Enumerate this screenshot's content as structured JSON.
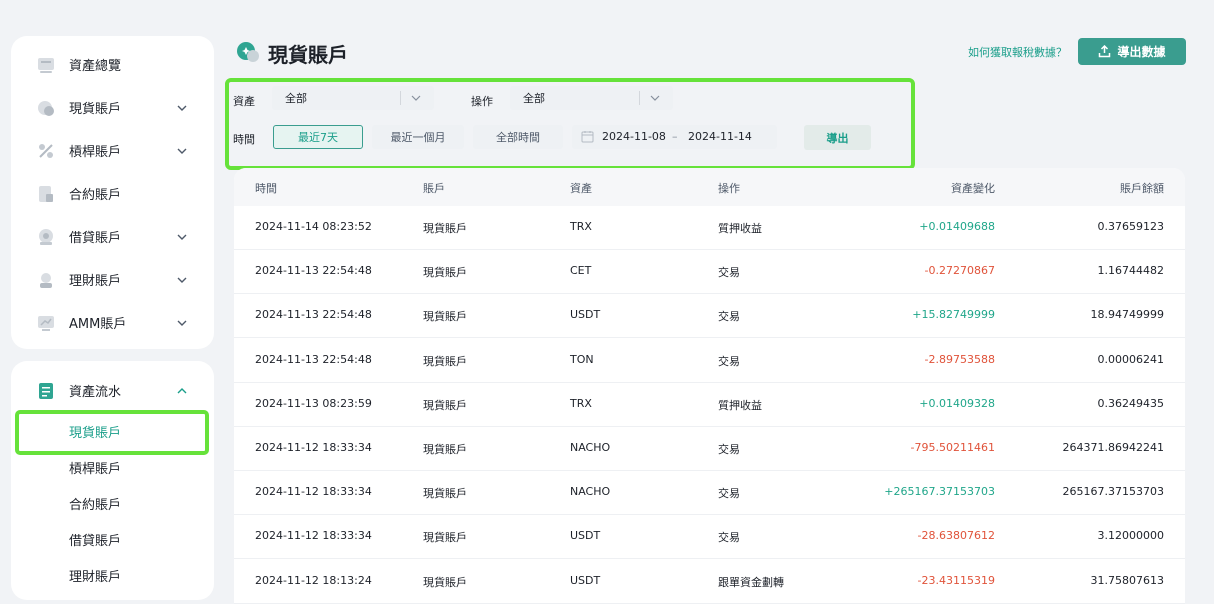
{
  "sidebar": {
    "items": [
      {
        "label": "資產總覽",
        "icon": "asset-overview-icon",
        "has_chevron": false
      },
      {
        "label": "現貨賬戶",
        "icon": "spot-account-icon",
        "has_chevron": true
      },
      {
        "label": "槓桿賬戶",
        "icon": "margin-percent-icon",
        "has_chevron": true
      },
      {
        "label": "合約賬戶",
        "icon": "futures-document-icon",
        "has_chevron": false
      },
      {
        "label": "借貸賬戶",
        "icon": "loan-icon",
        "has_chevron": true
      },
      {
        "label": "理財賬戶",
        "icon": "finance-icon",
        "has_chevron": true
      },
      {
        "label": "AMM賬戶",
        "icon": "amm-icon",
        "has_chevron": false,
        "chevron": true
      }
    ],
    "flow": {
      "label": "資產流水",
      "icon": "asset-flow-icon",
      "subitems": [
        "現貨賬戶",
        "槓桿賬戶",
        "合約賬戶",
        "借貸賬戶",
        "理財賬戶"
      ],
      "active_sub": "現貨賬戶"
    }
  },
  "header": {
    "title": "現貨賬戶",
    "tax_link": "如何獲取報稅數據？",
    "export_data": "導出數據"
  },
  "filters": {
    "asset_label": "資產",
    "asset_value": "全部",
    "op_label": "操作",
    "op_value": "全部",
    "time_label": "時間",
    "time_options": [
      "最近7天",
      "最近一個月",
      "全部時間"
    ],
    "time_active": "最近7天",
    "date_from": "2024-11-08",
    "date_to": "2024-11-14",
    "date_sep": "–",
    "export": "導出"
  },
  "table": {
    "headers": [
      "時間",
      "賬戶",
      "資產",
      "操作",
      "資產變化",
      "賬戶餘額"
    ],
    "rows": [
      {
        "time": "2024-11-14 08:23:52",
        "account": "現貨賬戶",
        "asset": "TRX",
        "op": "質押收益",
        "change": "+0.01409688",
        "sign": "pos",
        "balance": "0.37659123"
      },
      {
        "time": "2024-11-13 22:54:48",
        "account": "現貨賬戶",
        "asset": "CET",
        "op": "交易",
        "change": "-0.27270867",
        "sign": "neg",
        "balance": "1.16744482"
      },
      {
        "time": "2024-11-13 22:54:48",
        "account": "現貨賬戶",
        "asset": "USDT",
        "op": "交易",
        "change": "+15.82749999",
        "sign": "pos",
        "balance": "18.94749999"
      },
      {
        "time": "2024-11-13 22:54:48",
        "account": "現貨賬戶",
        "asset": "TON",
        "op": "交易",
        "change": "-2.89753588",
        "sign": "neg",
        "balance": "0.00006241"
      },
      {
        "time": "2024-11-13 08:23:59",
        "account": "現貨賬戶",
        "asset": "TRX",
        "op": "質押收益",
        "change": "+0.01409328",
        "sign": "pos",
        "balance": "0.36249435"
      },
      {
        "time": "2024-11-12 18:33:34",
        "account": "現貨賬戶",
        "asset": "NACHO",
        "op": "交易",
        "change": "-795.50211461",
        "sign": "neg",
        "balance": "264371.86942241"
      },
      {
        "time": "2024-11-12 18:33:34",
        "account": "現貨賬戶",
        "asset": "NACHO",
        "op": "交易",
        "change": "+265167.37153703",
        "sign": "pos",
        "balance": "265167.37153703"
      },
      {
        "time": "2024-11-12 18:33:34",
        "account": "現貨賬戶",
        "asset": "USDT",
        "op": "交易",
        "change": "-28.63807612",
        "sign": "neg",
        "balance": "3.12000000"
      },
      {
        "time": "2024-11-12 18:13:24",
        "account": "現貨賬戶",
        "asset": "USDT",
        "op": "跟單資金劃轉",
        "change": "-23.43115319",
        "sign": "neg",
        "balance": "31.75807613"
      }
    ]
  },
  "colors": {
    "accent": "#1a9e8a",
    "positive": "#20a68a",
    "negative": "#e0533a",
    "highlight": "#66e23a"
  }
}
